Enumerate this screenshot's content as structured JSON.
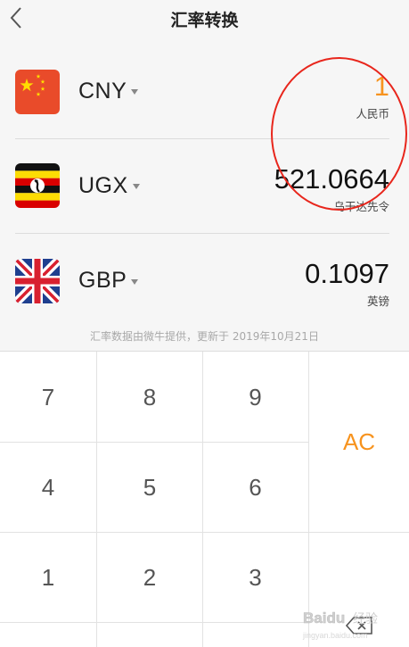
{
  "header": {
    "title": "汇率转换",
    "back_icon": "chevron-left-icon"
  },
  "currencies": [
    {
      "code": "CNY",
      "amount": "1",
      "name": "人民币",
      "flag": "china-flag-icon",
      "active": true
    },
    {
      "code": "UGX",
      "amount": "521.0664",
      "name": "乌干达先令",
      "flag": "uganda-flag-icon",
      "active": false
    },
    {
      "code": "GBP",
      "amount": "0.1097",
      "name": "英镑",
      "flag": "uk-flag-icon",
      "active": false
    }
  ],
  "source_note": "汇率数据由微牛提供，更新于 2019年10月21日",
  "keypad": {
    "keys": [
      "7",
      "8",
      "9",
      "4",
      "5",
      "6",
      "1",
      "2",
      "3"
    ],
    "clear_label": "AC",
    "backspace_icon": "backspace-icon"
  },
  "colors": {
    "accent": "#f7931e",
    "annotation": "#e8261c"
  },
  "watermark": {
    "text": "Baidu 经验"
  }
}
